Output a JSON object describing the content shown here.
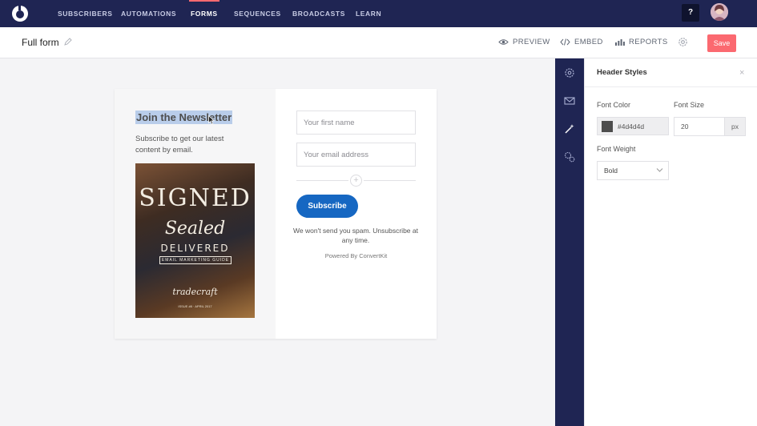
{
  "nav": {
    "items": [
      "SUBSCRIBERS",
      "AUTOMATIONS",
      "FORMS",
      "SEQUENCES",
      "BROADCASTS",
      "LEARN"
    ],
    "active": "FORMS",
    "help": "?"
  },
  "subheader": {
    "title": "Full form",
    "preview": "PREVIEW",
    "embed": "EMBED",
    "reports": "REPORTS",
    "save": "Save"
  },
  "form": {
    "heading": "Join the Newsletter",
    "description": "Subscribe to get our latest content by email.",
    "cover": {
      "line1": "SIGNED",
      "line2": "Sealed",
      "line3": "DELIVERED",
      "band": "EMAIL MARKETING GUIDE",
      "script": "tradecraft",
      "foot": "ISSUE #8 · APRIL 2017"
    },
    "first_name_placeholder": "Your first name",
    "email_placeholder": "Your email address",
    "add_symbol": "+",
    "subscribe": "Subscribe",
    "spam_note": "We won't send you spam. Unsubscribe at any time.",
    "powered_by": "Powered By ConvertKit"
  },
  "panel": {
    "title": "Header Styles",
    "close": "×",
    "font_color_label": "Font Color",
    "font_color_value": "#4d4d4d",
    "font_size_label": "Font Size",
    "font_size_value": "20",
    "font_size_unit": "px",
    "font_weight_label": "Font Weight",
    "font_weight_value": "Bold"
  },
  "colors": {
    "nav_bg": "#1f2553",
    "accent": "#fb6970",
    "button_blue": "#1667c2",
    "header_font": "#4d4d4d"
  },
  "icons": {
    "rail": [
      "gear-icon",
      "mail-icon",
      "magic-wand-icon",
      "cog-group-icon"
    ]
  }
}
